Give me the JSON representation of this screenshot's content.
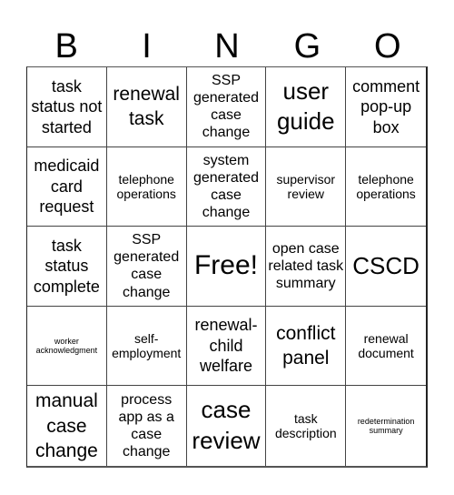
{
  "header": {
    "letters": [
      "B",
      "I",
      "N",
      "G",
      "O"
    ]
  },
  "cells": [
    {
      "text": "task status not started",
      "size": "l"
    },
    {
      "text": "renewal task",
      "size": "xl"
    },
    {
      "text": "SSP generated case change",
      "size": "m"
    },
    {
      "text": "user guide",
      "size": "xxl"
    },
    {
      "text": "comment pop-up box",
      "size": "l"
    },
    {
      "text": "medicaid card request",
      "size": "l"
    },
    {
      "text": "telephone operations",
      "size": "s"
    },
    {
      "text": "system generated case change",
      "size": "m"
    },
    {
      "text": "supervisor review",
      "size": "s"
    },
    {
      "text": "telephone operations",
      "size": "s"
    },
    {
      "text": "task status complete",
      "size": "l"
    },
    {
      "text": "SSP generated case change",
      "size": "m"
    },
    {
      "text": "Free!",
      "size": "free"
    },
    {
      "text": "open case related task summary",
      "size": "m"
    },
    {
      "text": "CSCD",
      "size": "xxl"
    },
    {
      "text": "worker acknowledgment",
      "size": "xs"
    },
    {
      "text": "self-employment",
      "size": "s"
    },
    {
      "text": "renewal-child welfare",
      "size": "l"
    },
    {
      "text": "conflict panel",
      "size": "xl"
    },
    {
      "text": "renewal document",
      "size": "s"
    },
    {
      "text": "manual case change",
      "size": "xl"
    },
    {
      "text": "process app as a case change",
      "size": "m"
    },
    {
      "text": "case review",
      "size": "xxl"
    },
    {
      "text": "task description",
      "size": "s"
    },
    {
      "text": "redetermination summary",
      "size": "xs"
    }
  ]
}
